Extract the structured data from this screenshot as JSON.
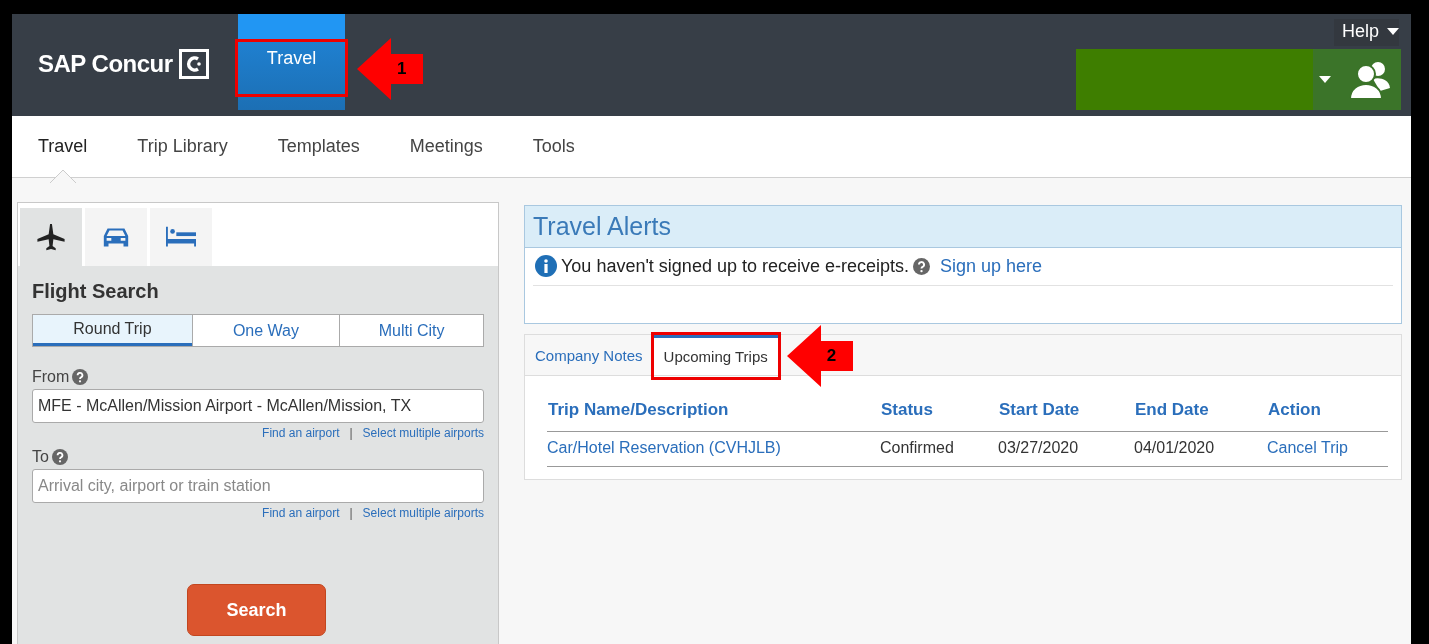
{
  "header": {
    "logo": "SAP Concur",
    "module_tabs": [
      {
        "label": "Travel",
        "selected": true,
        "callout": "1"
      }
    ],
    "help": "Help"
  },
  "subnav": [
    {
      "label": "Travel",
      "selected": true
    },
    {
      "label": "Trip Library",
      "selected": false
    },
    {
      "label": "Templates",
      "selected": false
    },
    {
      "label": "Meetings",
      "selected": false
    },
    {
      "label": "Tools",
      "selected": false
    }
  ],
  "search_panel": {
    "modes": [
      {
        "kind": "flight",
        "selected": true
      },
      {
        "kind": "car",
        "selected": false
      },
      {
        "kind": "hotel",
        "selected": false
      }
    ],
    "title": "Flight Search",
    "trip_types": [
      {
        "label": "Round Trip",
        "selected": true
      },
      {
        "label": "One Way",
        "selected": false
      },
      {
        "label": "Multi City",
        "selected": false
      }
    ],
    "fields": [
      {
        "label": "From",
        "value": "MFE - McAllen/Mission Airport - McAllen/Mission, TX",
        "links": [
          "Find an airport",
          "Select multiple airports"
        ],
        "link_separator": "|"
      },
      {
        "label": "To",
        "placeholder": "Arrival city, airport or train station",
        "links": [
          "Find an airport",
          "Select multiple airports"
        ],
        "link_separator": "|"
      }
    ],
    "search_button": "Search"
  },
  "alerts": {
    "title": "Travel Alerts",
    "message": "You haven't signed up to receive e-receipts.",
    "link": "Sign up here"
  },
  "trip_tabs": [
    {
      "label": "Company Notes",
      "selected": false
    },
    {
      "label": "Upcoming Trips",
      "selected": true,
      "callout": "2"
    }
  ],
  "table": {
    "columns": [
      "Trip Name/Description",
      "Status",
      "Start Date",
      "End Date",
      "Action"
    ],
    "rows": [
      {
        "trip": "Car/Hotel Reservation (CVHJLB)",
        "status": "Confirmed",
        "start": "03/27/2020",
        "end": "04/01/2020",
        "action": "Cancel Trip"
      }
    ]
  }
}
